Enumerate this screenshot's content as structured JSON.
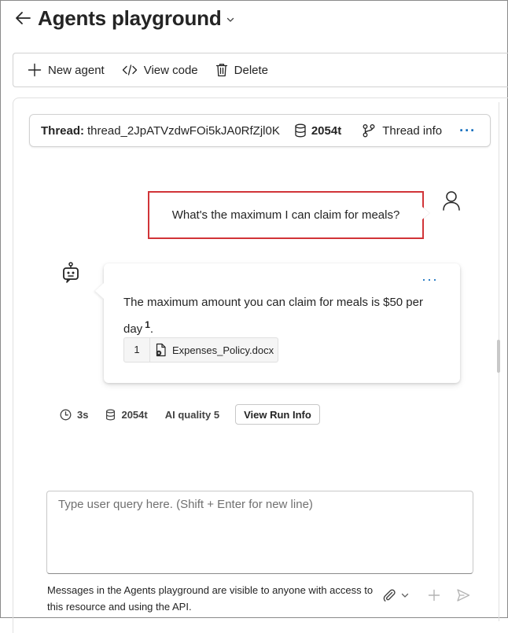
{
  "header": {
    "title": "Agents playground"
  },
  "toolbar": {
    "new_agent": "New agent",
    "view_code": "View code",
    "delete": "Delete"
  },
  "thread": {
    "label": "Thread:",
    "id": "thread_2JpATVzdwFOi5kJA0RfZjl0K",
    "tokens": "2054t",
    "info_label": "Thread info",
    "more": "···"
  },
  "messages": {
    "user": {
      "text": "What's the maximum I can claim for meals?"
    },
    "assistant": {
      "more": "···",
      "text": "The maximum amount you can claim for meals is $50 per day",
      "footnote": "1",
      "trailing": ".",
      "citation": {
        "number": "1",
        "file": "Expenses_Policy.docx"
      }
    }
  },
  "run_stats": {
    "duration": "3s",
    "tokens": "2054t",
    "quality": "AI quality 5",
    "view_run_info": "View Run Info"
  },
  "input": {
    "placeholder": "Type user query here. (Shift + Enter for new line)",
    "value": "",
    "notice": "Messages in the Agents playground are visible to anyone with access to this resource and using the API."
  },
  "colors": {
    "accent": "#0f6cbd",
    "highlight_border": "#d13438",
    "text": "#242424"
  },
  "icons": {
    "back": "arrow-left-icon",
    "title_dropdown": "chevron-down-icon",
    "new_agent": "plus-icon",
    "view_code": "code-icon",
    "delete": "trash-icon",
    "tokens": "database-icon",
    "thread_info": "branch-icon",
    "user": "person-icon",
    "assistant": "bot-icon",
    "document": "document-link-icon",
    "clock": "clock-icon",
    "attach": "paperclip-icon",
    "add": "plus-icon",
    "send": "send-icon"
  }
}
